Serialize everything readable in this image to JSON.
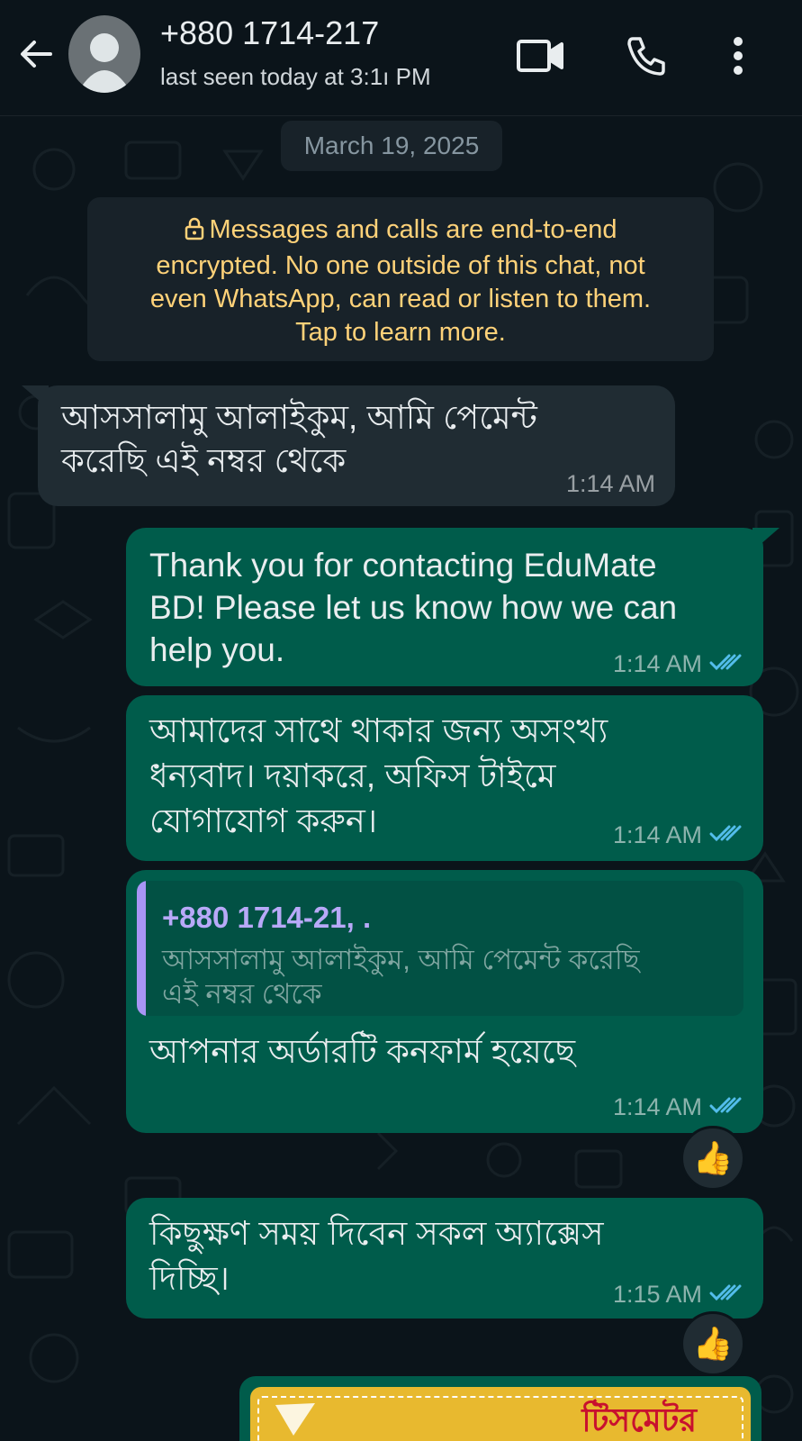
{
  "header": {
    "contact_name": "+880 1714-217",
    "status": "last seen today at 3:1ı РΜ"
  },
  "date_chip": "March 19, 2025",
  "encryption_notice": {
    "lines": [
      "Messages and calls are end-to-end",
      "encrypted. No one outside of this chat, not",
      "even WhatsApp, can read or listen to them.",
      "Tap to learn more."
    ]
  },
  "messages": [
    {
      "direction": "incoming",
      "lines": [
        "আসসালামু আলাইকুম, আমি পেমেন্ট",
        "করেছি এই নম্বর থেকে"
      ],
      "time": "1:14 AM"
    },
    {
      "direction": "outgoing",
      "lines": [
        "Thank you for contacting EduMate",
        "BD! Please let us know how we can",
        "help you."
      ],
      "time": "1:14 AM",
      "status": "read"
    },
    {
      "direction": "outgoing",
      "lines": [
        "আমাদের সাথে থাকার জন্য অসংখ্য",
        "ধন্যবাদ। দয়াকরে, অফিস টাইমে",
        "যোগাযোগ করুন।"
      ],
      "time": "1:14 AM",
      "status": "read"
    },
    {
      "direction": "outgoing",
      "quote": {
        "name": "+880 1714-21, .",
        "lines": [
          "আসসালামু আলাইকুম, আমি পেমেন্ট করেছি",
          "এই নম্বর থেকে"
        ]
      },
      "lines": [
        "আপনার অর্ডারটি কনফার্ম হয়েছে"
      ],
      "time": "1:14 AM",
      "status": "read",
      "reaction": "👍"
    },
    {
      "direction": "outgoing",
      "lines": [
        "কিছুক্ষণ সময় দিবেন সকল অ্যাক্সেস",
        "দিচ্ছি।"
      ],
      "time": "1:15 AM",
      "status": "read",
      "reaction": "👍"
    }
  ],
  "image_message": {
    "caption_fragment": "টিসমেটর"
  },
  "colors": {
    "background": "#0b141a",
    "incoming_bubble": "#202c33",
    "outgoing_bubble": "#005c4b",
    "notice_text": "#ffd279",
    "read_ticks": "#53bdeb",
    "quote_accent": "#a895f5"
  },
  "icons": {
    "back": "arrow-left-icon",
    "video": "video-call-icon",
    "voice": "voice-call-icon",
    "menu": "more-vert-icon",
    "lock": "lock-icon",
    "ticks": "double-check-icon",
    "reaction": "thumbs-up-emoji"
  }
}
